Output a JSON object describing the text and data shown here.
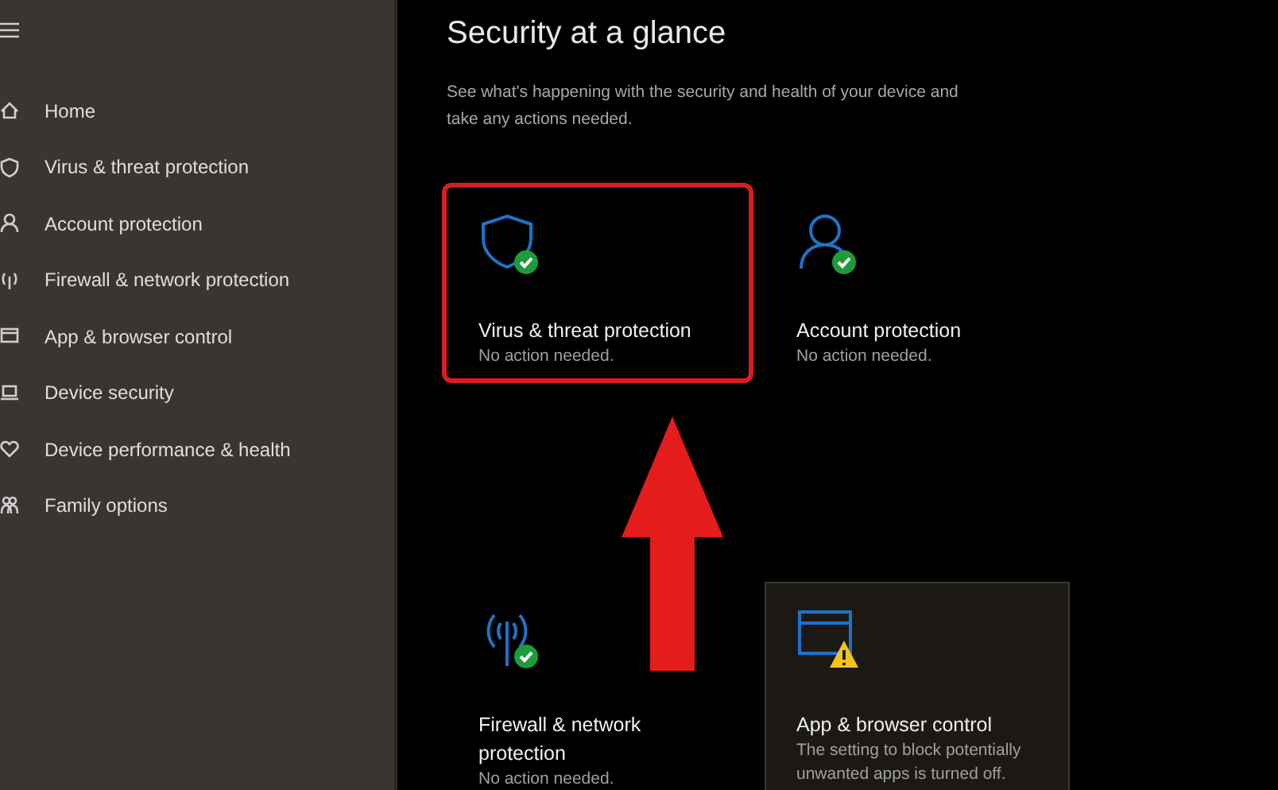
{
  "sidebar": {
    "items": [
      {
        "label": "Home"
      },
      {
        "label": "Virus & threat protection"
      },
      {
        "label": "Account protection"
      },
      {
        "label": "Firewall & network protection"
      },
      {
        "label": "App & browser control"
      },
      {
        "label": "Device security"
      },
      {
        "label": "Device performance & health"
      },
      {
        "label": "Family options"
      }
    ]
  },
  "main": {
    "title": "Security at a glance",
    "subtitle": "See what's happening with the security and health of your device and take any actions needed.",
    "cards": [
      {
        "kind": "shield",
        "warning": false,
        "title": "Virus & threat protection",
        "detail": "No action needed.",
        "highlighted": true,
        "hovered": false
      },
      {
        "kind": "person",
        "warning": false,
        "title": "Account protection",
        "detail": "No action needed.",
        "highlighted": false,
        "hovered": false
      },
      {
        "kind": "antenna",
        "warning": false,
        "title": "Firewall & network protection",
        "detail": "No action needed.",
        "highlighted": false,
        "hovered": false
      },
      {
        "kind": "window",
        "warning": true,
        "title": "App & browser control",
        "detail": "The setting to block potentially unwanted apps is turned off.",
        "highlighted": false,
        "hovered": true
      }
    ]
  }
}
